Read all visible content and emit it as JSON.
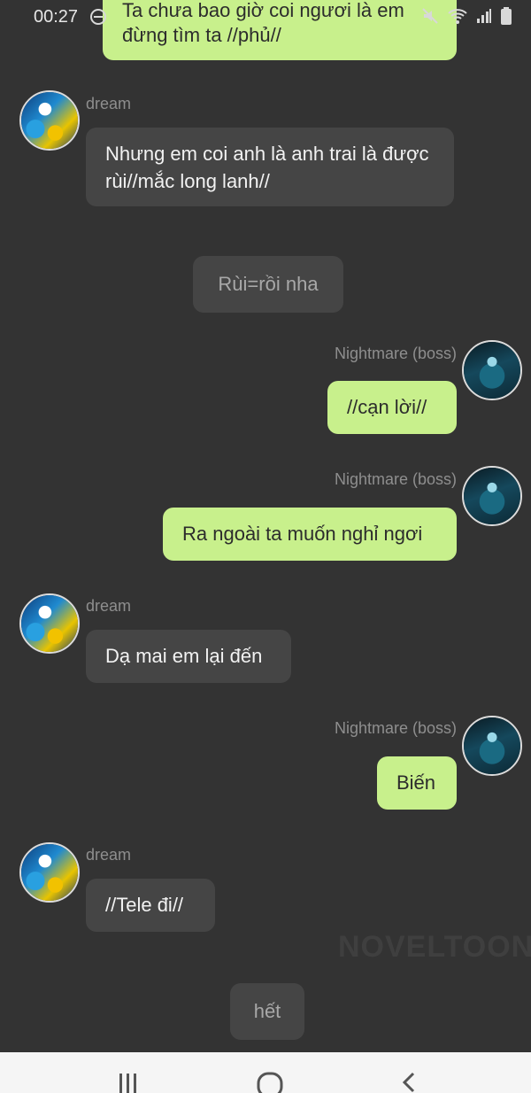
{
  "status_bar": {
    "time": "00:27"
  },
  "messages": [
    {
      "sender": "boss",
      "name": "",
      "text": "Ta chưa bao giờ coi ngươi là em đừng tìm ta //phủ//"
    },
    {
      "sender": "dream",
      "name": "dream",
      "text": "Nhưng em coi anh là anh trai là được rùi//mắc long lanh//"
    },
    {
      "sender": "narration",
      "text": "Rùi=rồi nha"
    },
    {
      "sender": "boss",
      "name": "Nightmare (boss)",
      "text": "//cạn lời//"
    },
    {
      "sender": "boss",
      "name": "Nightmare (boss)",
      "text": "Ra ngoài ta muốn nghỉ ngơi"
    },
    {
      "sender": "dream",
      "name": "dream",
      "text": "Dạ mai em lại đến"
    },
    {
      "sender": "boss",
      "name": "Nightmare (boss)",
      "text": "Biến"
    },
    {
      "sender": "dream",
      "name": "dream",
      "text": "//Tele đi//"
    },
    {
      "sender": "narration",
      "text": "hết"
    }
  ],
  "watermark": "NOVELTOON",
  "icons": {
    "status": [
      "do-not-disturb-icon",
      "mute-icon",
      "wifi-icon",
      "signal-icon",
      "battery-icon"
    ],
    "nav": [
      "recent-apps-icon",
      "home-icon",
      "back-icon"
    ]
  },
  "colors": {
    "background": "#333333",
    "left_bubble": "#454545",
    "right_bubble": "#c8f08c",
    "name_text": "#8e8e8e"
  }
}
